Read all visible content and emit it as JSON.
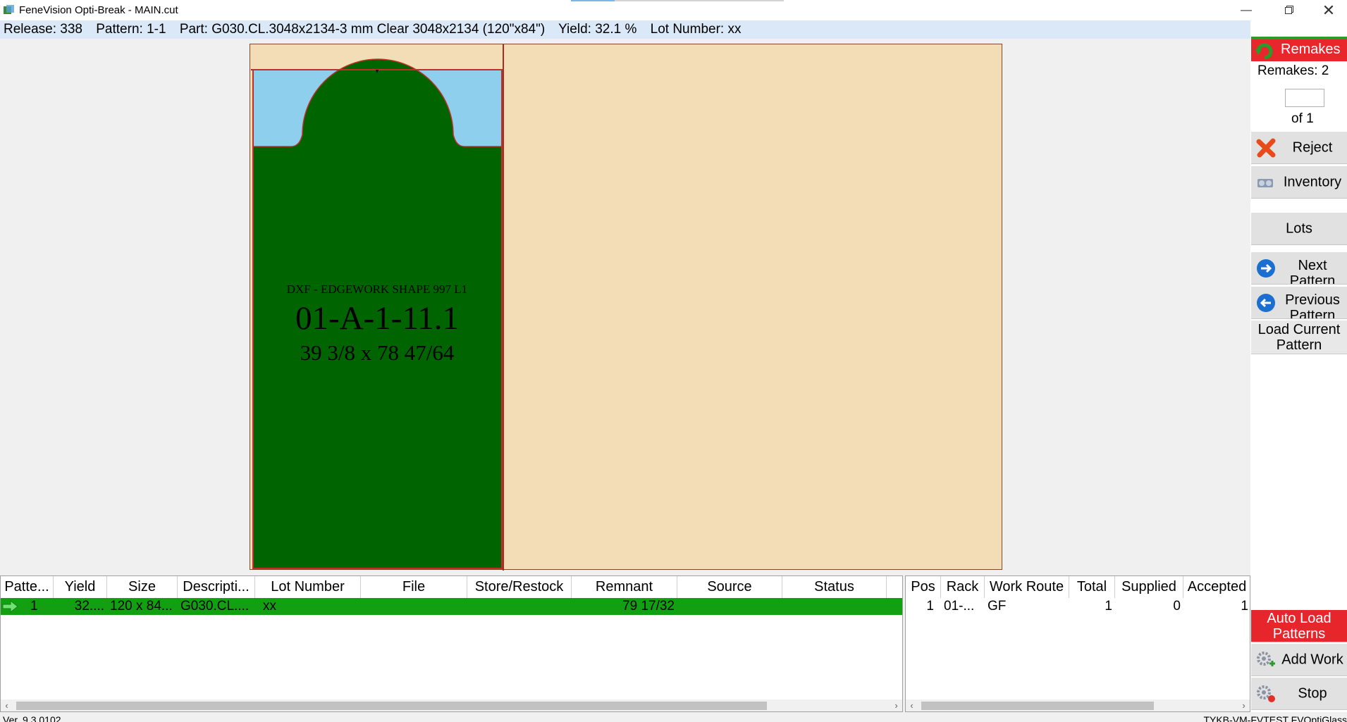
{
  "window": {
    "title": "FeneVision Opti-Break - MAIN.cut",
    "restore_icon": "restore-icon",
    "close_icon": "close-icon",
    "minimize_icon": "minimize-icon"
  },
  "infobar": {
    "release": "Release: 338",
    "pattern": "Pattern: 1-1",
    "part": "Part: G030.CL.3048x2134-3 mm Clear 3048x2134 (120\"x84\")",
    "yield": "Yield: 32.1 %",
    "lot": "Lot Number: xx"
  },
  "part_label": {
    "shape": "DXF - EDGEWORK SHAPE 997 L1",
    "id": "01-A-1-11.1",
    "size": "39 3/8 x 78 47/64"
  },
  "sidebar": {
    "remakes_button": "Remakes",
    "remakes_count": "Remakes: 2",
    "page_value": "",
    "page_of": "of 1",
    "reject": "Reject",
    "inventory": "Inventory",
    "lots": "Lots",
    "next_pattern": "Next Pattern",
    "previous_pattern": "Previous Pattern",
    "load_current": "Load Current Pattern",
    "auto_load": "Auto Load Patterns",
    "add_work": "Add Work",
    "stop": "Stop"
  },
  "patterns_table": {
    "columns": [
      "Patte...",
      "Yield",
      "Size",
      "Descripti...",
      "Lot Number",
      "File",
      "Store/Restock",
      "Remnant",
      "Source",
      "Status"
    ],
    "rows": [
      {
        "pattern": "1",
        "yield": "32....",
        "size": "120 x 84...",
        "description": "G030.CL....",
        "lot": "xx",
        "file": "",
        "store": "",
        "remnant": "79 17/32",
        "source": "",
        "status": ""
      }
    ]
  },
  "parts_table": {
    "columns": [
      "Pos",
      "Rack",
      "Work Route",
      "Total",
      "Supplied",
      "Accepted"
    ],
    "rows": [
      {
        "pos": "1",
        "rack": "01-...",
        "route": "GF",
        "total": "1",
        "supplied": "0",
        "accepted": "1"
      }
    ]
  },
  "status": {
    "version": "Ver. 9.3.0102",
    "host": "TYKB-VM-FVTEST FVOptiGlass"
  },
  "colors": {
    "sheet": "#f3ddb6",
    "glass": "#8ecfed",
    "part": "#006400",
    "selected_row": "#12a012",
    "remakes": "#e8262c",
    "infobar": "#dbe8f7"
  }
}
